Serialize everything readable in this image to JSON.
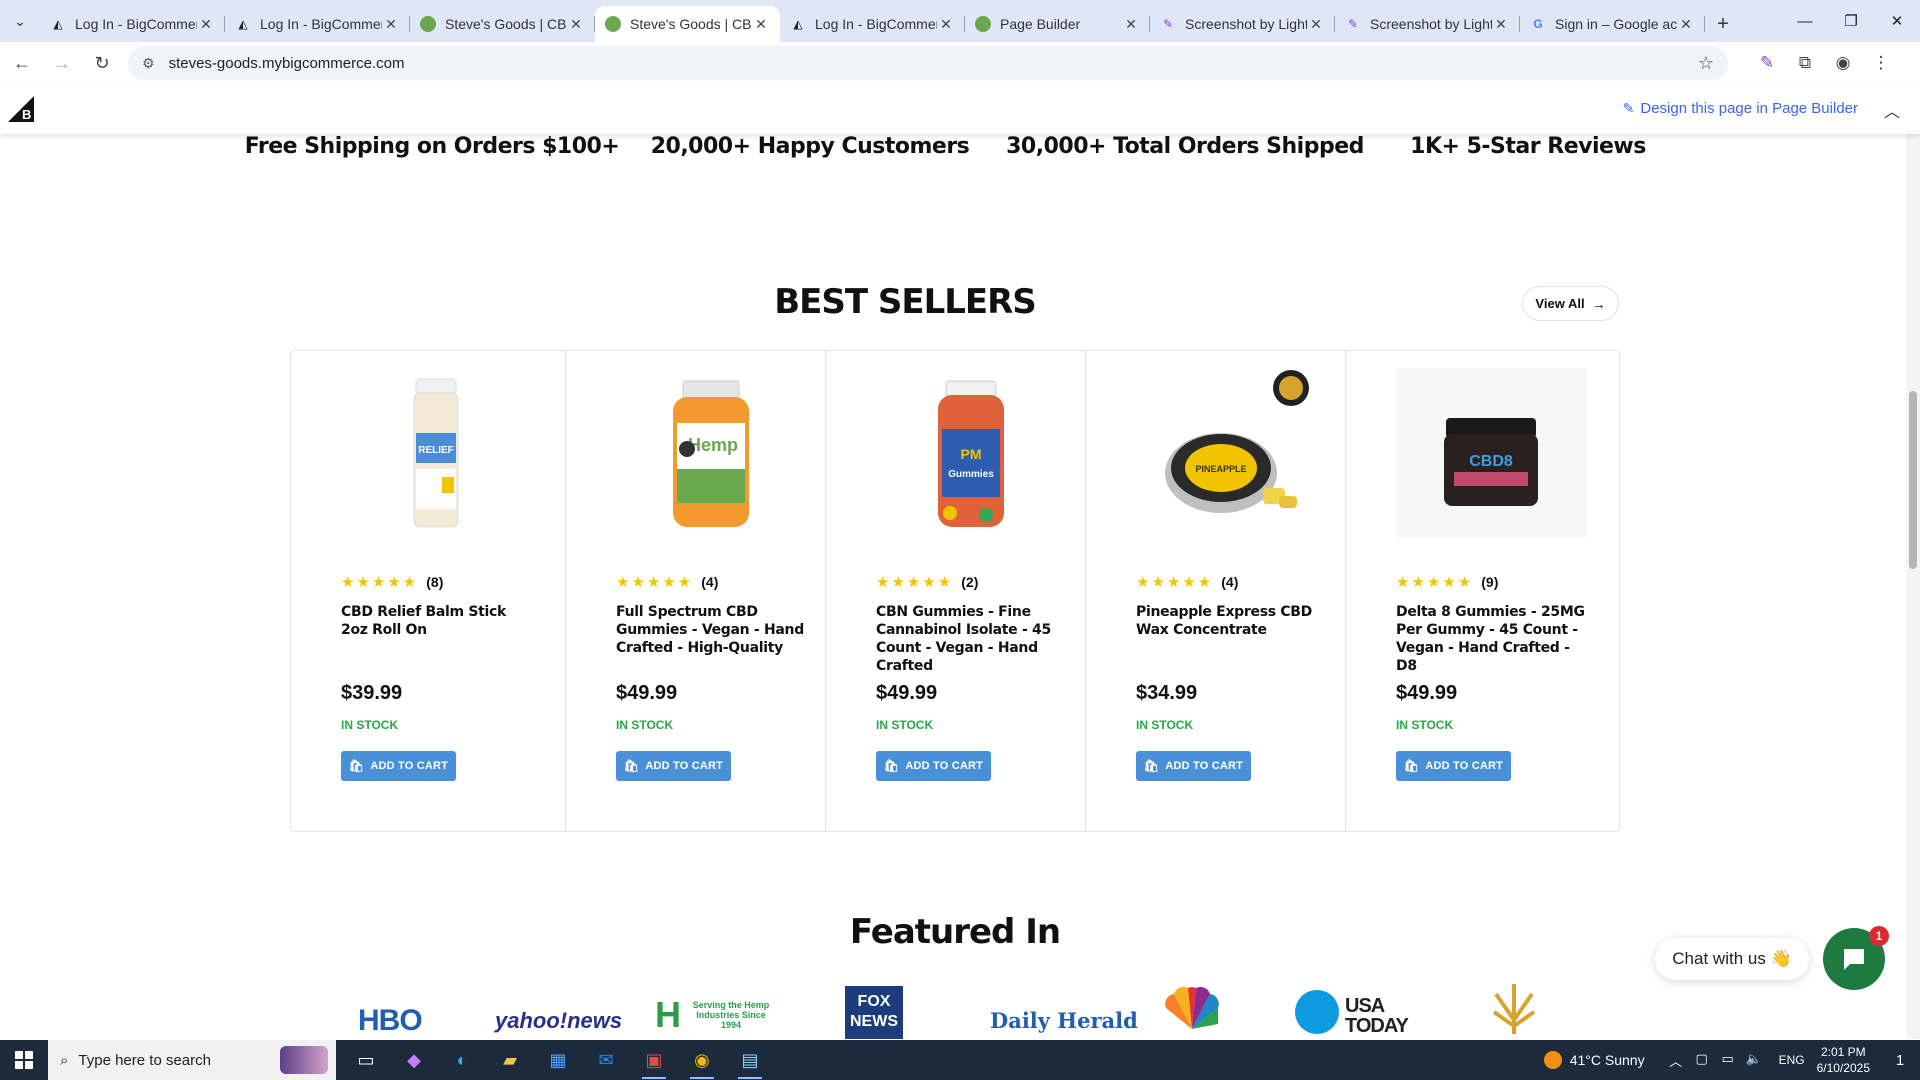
{
  "browser": {
    "tabs": [
      {
        "title": "Log In - BigCommerce",
        "favicon": "bigcommerce-icon",
        "active": false
      },
      {
        "title": "Log In - BigCommerce",
        "favicon": "bigcommerce-icon",
        "active": false
      },
      {
        "title": "Steve's Goods | CBD,",
        "favicon": "leaf-icon",
        "active": false
      },
      {
        "title": "Steve's Goods | CBD,",
        "favicon": "leaf-icon",
        "active": true
      },
      {
        "title": "Log In - BigCommerce",
        "favicon": "bigcommerce-icon",
        "active": false
      },
      {
        "title": "Page Builder",
        "favicon": "leaf-icon",
        "active": false
      },
      {
        "title": "Screenshot by Lightshot",
        "favicon": "pen-icon",
        "active": false
      },
      {
        "title": "Screenshot by Lightshot",
        "favicon": "pen-icon",
        "active": false
      },
      {
        "title": "Sign in – Google accounts",
        "favicon": "google-icon",
        "active": false
      }
    ],
    "url": "steves-goods.mybigcommerce.com"
  },
  "bc_bar": {
    "design_link": "Design this page in Page Builder"
  },
  "features": [
    {
      "text": "Free Shipping on Orders $100+"
    },
    {
      "text": "20,000+ Happy Customers"
    },
    {
      "text": "30,000+ Total Orders Shipped"
    },
    {
      "text": "1K+ 5-Star Reviews"
    }
  ],
  "best_sellers": {
    "title": "BEST SELLERS",
    "view_all": "View All",
    "products": [
      {
        "name": "CBD Relief Balm Stick 2oz Roll On",
        "rating_count": "(8)",
        "price": "$39.99",
        "stock": "IN STOCK",
        "cart": "ADD TO CART",
        "stars": 5
      },
      {
        "name": "Full Spectrum CBD Gummies - Vegan - Hand Crafted - High-Quality",
        "rating_count": "(4)",
        "price": "$49.99",
        "stock": "IN STOCK",
        "cart": "ADD TO CART",
        "stars": 5
      },
      {
        "name": "CBN Gummies - Fine Cannabinol Isolate - 45 Count - Vegan - Hand Crafted",
        "rating_count": "(2)",
        "price": "$49.99",
        "stock": "IN STOCK",
        "cart": "ADD TO CART",
        "stars": 5
      },
      {
        "name": "Pineapple Express CBD Wax Concentrate",
        "rating_count": "(4)",
        "price": "$34.99",
        "stock": "IN STOCK",
        "cart": "ADD TO CART",
        "stars": 5
      },
      {
        "name": "Delta 8 Gummies - 25MG Per Gummy - 45 Count - Vegan - Hand Crafted - D8",
        "rating_count": "(9)",
        "price": "$49.99",
        "stock": "IN STOCK",
        "cart": "ADD TO CART",
        "stars": 5
      }
    ]
  },
  "featured_in": {
    "title": "Featured In",
    "logos": [
      "HBO",
      "yahoo!news",
      "Serving the Hemp Industries Since 1994",
      "FOX NEWS",
      "Daily Herald",
      "NBC",
      "USA TODAY",
      "hemp-leaf"
    ]
  },
  "chat": {
    "label": "Chat with us 👋",
    "badge": "1"
  },
  "taskbar": {
    "search_placeholder": "Type here to search",
    "weather": "41°C  Sunny",
    "language": "ENG",
    "time": "2:01 PM",
    "date": "6/10/2025",
    "notif_count": "1"
  },
  "colors": {
    "accent_green": "#6aa84f",
    "cart_button": "#4a90d9",
    "in_stock": "#27a844",
    "star": "#f2c400",
    "chat_button": "#1e7a3e",
    "design_link": "#3c64f4"
  }
}
